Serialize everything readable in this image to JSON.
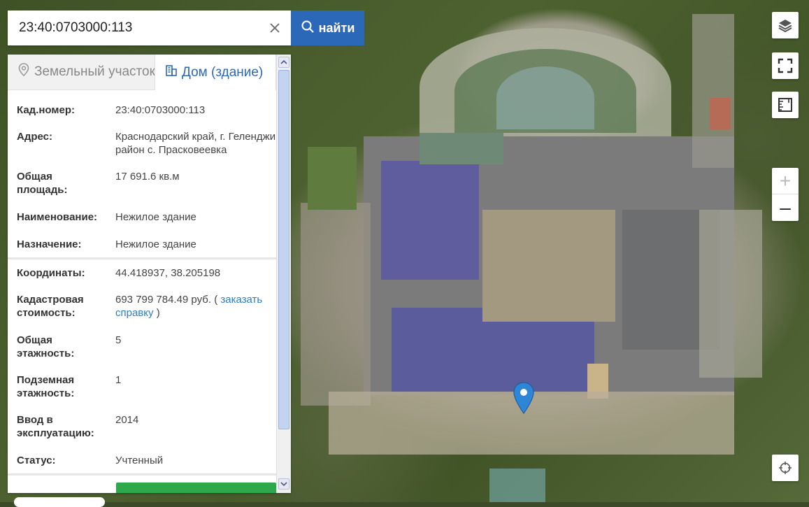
{
  "search": {
    "value": "23:40:0703000:113",
    "button_label": "найти"
  },
  "tabs": {
    "land": "Земельный участок",
    "building": "Дом (здание)"
  },
  "details": {
    "cadastral_number": {
      "label": "Кад.номер:",
      "value": "23:40:0703000:113"
    },
    "address": {
      "label": "Адрес:",
      "line1": "Краснодарский край, г. Геленджик,",
      "line2": "район с. Прасковеевка"
    },
    "total_area": {
      "label_line1": "Общая",
      "label_line2": "площадь:",
      "value": "17 691.6 кв.м"
    },
    "name": {
      "label": "Наименование:",
      "value": "Нежилое здание"
    },
    "purpose": {
      "label": "Назначение:",
      "value": "Нежилое здание"
    },
    "coordinates": {
      "label": "Координаты:",
      "value": "44.418937, 38.205198"
    },
    "cadastral_value": {
      "label_line1": "Кадастровая",
      "label_line2": "стоимость:",
      "value_prefix": "693 799 784.49 руб. (",
      "link_word1": "заказать",
      "link_word2": "справку",
      "value_suffix": ")"
    },
    "floors": {
      "label_line1": "Общая",
      "label_line2": "этажность:",
      "value": "5"
    },
    "underground_floors": {
      "label_line1": "Подземная",
      "label_line2": "этажность:",
      "value": "1"
    },
    "commissioning": {
      "label_line1": "Ввод в",
      "label_line2": "эксплуатацию:",
      "value": "2014"
    },
    "status": {
      "label": "Статус:",
      "value": "Учтенный"
    }
  },
  "colors": {
    "accent": "#2c68b8",
    "link": "#2c7fc4",
    "order_button": "#2ea84a",
    "marker": "#2f86d6"
  },
  "icons": {
    "search": "search-icon",
    "clear": "close-icon",
    "land_tab": "location-pin-icon",
    "building_tab": "building-icon",
    "layers": "layers-icon",
    "fullscreen": "fullscreen-icon",
    "ruler": "ruler-icon",
    "zoom_in": "plus-icon",
    "zoom_out": "minus-icon",
    "locate": "crosshair-icon",
    "marker": "map-marker-icon"
  }
}
